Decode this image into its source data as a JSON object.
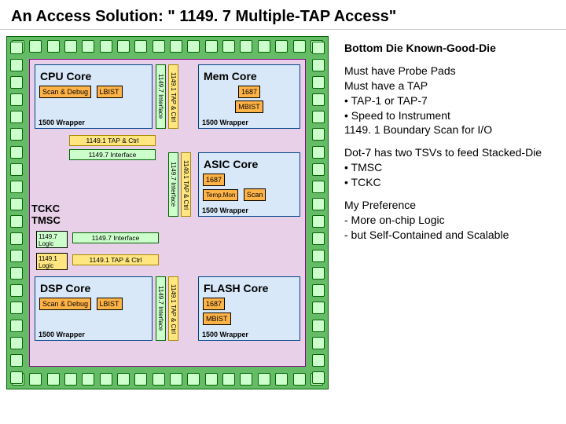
{
  "title": "An Access Solution: \" 1149. 7 Multiple-TAP Access\"",
  "kgd": "Bottom Die Known-Good-Die",
  "must": "Must have Probe Pads\nMust have a TAP\n• TAP-1 or TAP-7\n• Speed to Instrument\n1149. 1 Boundary Scan for I/O",
  "dot7": "Dot-7 has two TSVs to feed Stacked-Die\n• TMSC\n• TCKC",
  "pref": "My Preference\n- More on-chip Logic\n- but Self-Contained and Scalable",
  "labels": {
    "cpu": "CPU Core",
    "mem": "Mem Core",
    "asic": "ASIC Core",
    "dsp": "DSP Core",
    "flash": "FLASH Core",
    "scanDebug": "Scan & Debug",
    "lbist": "LBIST",
    "mbist": "MBIST",
    "tempmon": "Temp.Mon",
    "scan": "Scan",
    "code1687": "1687",
    "wrap": "1500 Wrapper",
    "tap1": "1149.1 TAP & Ctrl",
    "if7": "1149.7 Interface",
    "logic7": "1149.7 Logic",
    "logic1": "1149.1 Logic",
    "tckc": "TCKC",
    "tmsc": "TMSC"
  }
}
